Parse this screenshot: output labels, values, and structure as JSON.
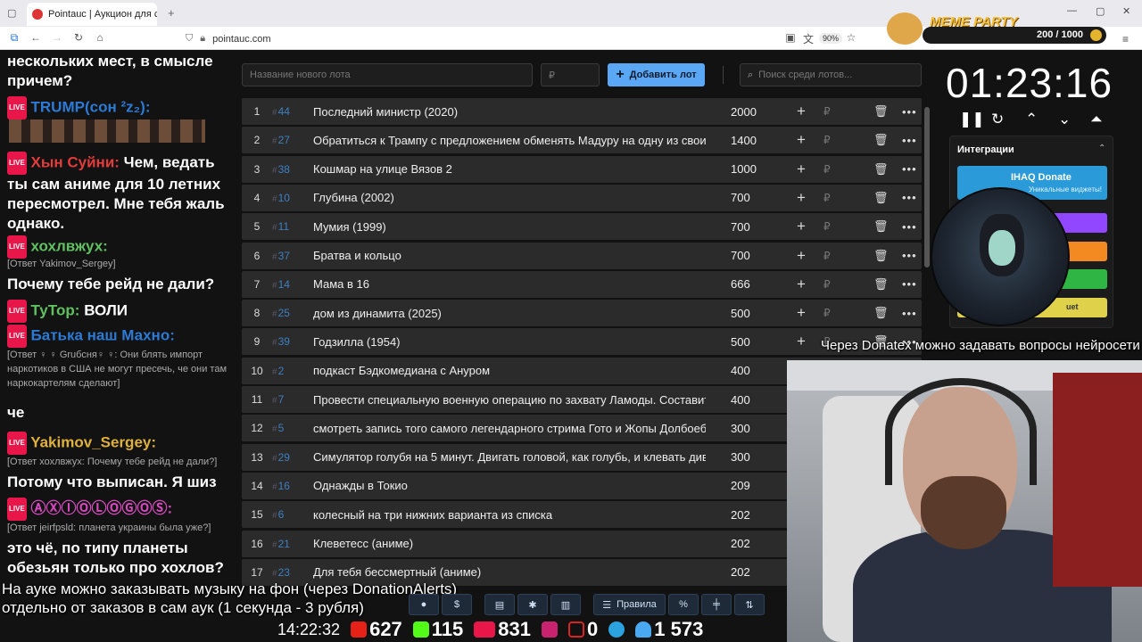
{
  "browser": {
    "tab_title": "Pointauc | Аукцион для стрима",
    "url": "pointauc.com",
    "zoom": "90%"
  },
  "chat": {
    "messages": [
      {
        "name": "",
        "text": "нескольких мест, в смысле причем?"
      },
      {
        "name": "TRUMP⁢⁢⁢⁢⁢(сон ²z₂):",
        "text": "",
        "color": "#2b7bd6"
      },
      {
        "name": "Хын Суйни:",
        "text": "Чем, ведать ты сам аниме для 10 летних пересмотрел. Мне тебя жаль однако.",
        "color": "#e43b3b"
      },
      {
        "name": "хохлвжух:",
        "text": "",
        "color": "#5fc15f",
        "reply": "[Ответ Yakimov_Sergey]"
      },
      {
        "name": "",
        "text": "Почему тебе рейд не дали?"
      },
      {
        "name": "ТуТор:",
        "text": "ВОЛИ",
        "color": "#5fc15f"
      },
      {
        "name": "Батька наш Махно:",
        "text": "",
        "color": "#2b7bd6",
        "reply": "[Ответ ♀ ♀ Gruбсня♀ ♀: Они блять импорт наркотиков в США не могут пресечь, че они там наркокартелям сделают]"
      },
      {
        "name": "",
        "text": "че"
      },
      {
        "name": "Yakimov_Sergey:",
        "text": "",
        "color": "#e0b23a",
        "reply": "[Ответ хохлвжух: Почему тебе рейд не дали?]"
      },
      {
        "name": "",
        "text": "Потому что выписан. Я шиз"
      },
      {
        "name": "ⒶⓍⒾⓄⓁⓄⒼⓄⓈ:",
        "text": "",
        "color": "#d64bbf",
        "reply": "[Ответ jeirfpsld: планета украины была уже?]"
      },
      {
        "name": "",
        "text": "это чё, по типу планеты обезьян только про хохлов?"
      }
    ],
    "live_label": "LIVE"
  },
  "toolbar": {
    "new_lot_placeholder": "Название нового лота",
    "amount_placeholder": "₽",
    "add_label": "Добавить лот",
    "search_placeholder": "Поиск среди лотов..."
  },
  "lots": [
    {
      "n": "1",
      "id": "44",
      "name": "Последний министр (2020)",
      "amount": "2000"
    },
    {
      "n": "2",
      "id": "27",
      "name": "Обратиться к Трампу с предложением обменять Мадуру на одну из своих к",
      "amount": "1400"
    },
    {
      "n": "3",
      "id": "38",
      "name": "Кошмар на улице Вязов 2",
      "amount": "1000"
    },
    {
      "n": "4",
      "id": "10",
      "name": "Глубина (2002)",
      "amount": "700"
    },
    {
      "n": "5",
      "id": "11",
      "name": "Мумия (1999)",
      "amount": "700"
    },
    {
      "n": "6",
      "id": "37",
      "name": "Братва и кольцо",
      "amount": "700"
    },
    {
      "n": "7",
      "id": "14",
      "name": "Мама в 16",
      "amount": "666"
    },
    {
      "n": "8",
      "id": "25",
      "name": "дом из динамита (2025)",
      "amount": "500"
    },
    {
      "n": "9",
      "id": "39",
      "name": "Годзилла (1954)",
      "amount": "500"
    },
    {
      "n": "10",
      "id": "2",
      "name": "подкаст Бэдкомедиана с Ануром",
      "amount": "400"
    },
    {
      "n": "11",
      "id": "7",
      "name": "Провести специальную военную операцию по захвату Ламоды. Составить г",
      "amount": "400"
    },
    {
      "n": "12",
      "id": "5",
      "name": "смотреть запись того самого легендарного стрима Гото и Жопы Долбоебус:",
      "amount": "300"
    },
    {
      "n": "13",
      "id": "29",
      "name": "Симулятор голубя на 5 минут. Двигать головой, как голубь, и клевать диван",
      "amount": "300"
    },
    {
      "n": "14",
      "id": "16",
      "name": "Однажды в Токио",
      "amount": "209"
    },
    {
      "n": "15",
      "id": "6",
      "name": "колесный на три нижних варианта из списка",
      "amount": "202"
    },
    {
      "n": "16",
      "id": "21",
      "name": "Клеветесс (аниме)",
      "amount": "202"
    },
    {
      "n": "17",
      "id": "23",
      "name": "Для тебя бессмертный (аниме)",
      "amount": "202"
    }
  ],
  "timer": {
    "value": "01:23:16"
  },
  "integrations": {
    "title": "Интеграции",
    "ihaq_label": "IHAQ Donate",
    "ihaq_sub": "Уникальные виджеты!",
    "last_label": "uet"
  },
  "meme": {
    "label": "MEME PARTY",
    "counter": "200 / 1000"
  },
  "overlays": {
    "donatex": "Через Donatex можно задавать вопросы нейросети",
    "music_line1": "На ауке можно заказывать музыку на фон (через DonationAlerts)",
    "music_line2": "отдельно от заказов в сам аук (1 секунда - 3 рубля)",
    "rules_label": "Правила",
    "percent_label": "%"
  },
  "stats": {
    "time": "14:22:32",
    "youtube": "627",
    "kick": "115",
    "vk": "831",
    "play": "",
    "rutube": "0",
    "telegram": "",
    "viewers": "1 573"
  },
  "colors": {
    "accent": "#5aa8f5",
    "live": "#e9164a",
    "twitch": "#9147ff"
  }
}
